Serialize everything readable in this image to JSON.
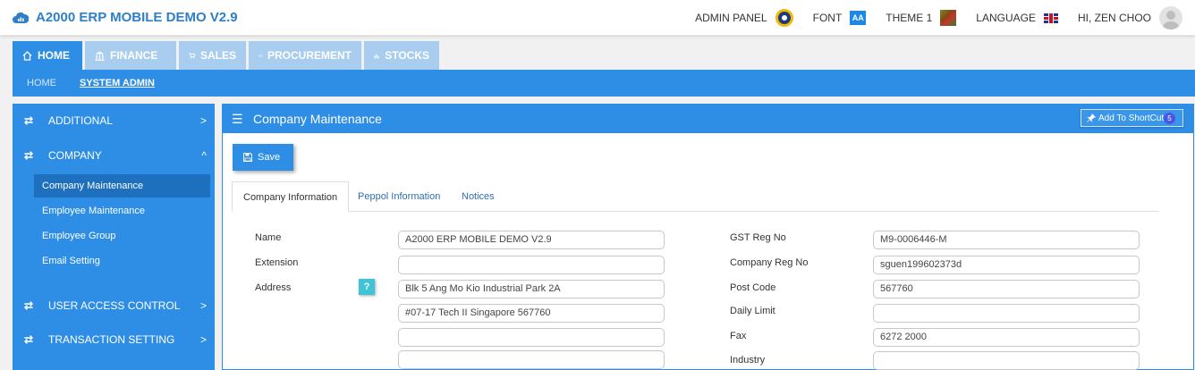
{
  "app": {
    "title": "A2000 ERP MOBILE DEMO V2.9"
  },
  "header": {
    "admin_panel": "ADMIN PANEL",
    "font": "FONT",
    "font_icon_text": "AA",
    "theme": "THEME 1",
    "language": "LANGUAGE",
    "user": "HI, ZEN CHOO"
  },
  "modules": [
    {
      "label": "HOME",
      "icon": "home-icon",
      "active": true
    },
    {
      "label": "FINANCE",
      "icon": "bank-icon",
      "active": false
    },
    {
      "label": "SALES",
      "icon": "cart-icon",
      "active": false
    },
    {
      "label": "PROCUREMENT",
      "icon": "megaphone-icon",
      "active": false
    },
    {
      "label": "STOCKS",
      "icon": "bar-chart-icon",
      "active": false
    }
  ],
  "subnav": {
    "items": [
      "HOME",
      "SYSTEM ADMIN"
    ],
    "current": "SYSTEM ADMIN"
  },
  "sidebar": {
    "sections": [
      {
        "label": "ADDITIONAL",
        "chevron": ">"
      },
      {
        "label": "COMPANY",
        "chevron": "^"
      },
      {
        "label": "USER ACCESS CONTROL",
        "chevron": ">"
      },
      {
        "label": "TRANSACTION SETTING",
        "chevron": ">"
      }
    ],
    "company_items": [
      "Company Maintenance",
      "Employee Maintenance",
      "Employee Group",
      "Email Setting"
    ],
    "selected": "Company Maintenance"
  },
  "panel": {
    "title": "Company Maintenance",
    "shortcut_label": "Add To ShortCut",
    "shortcut_badge": "5",
    "save_label": "Save",
    "tabs": [
      "Company Information",
      "Peppol Information",
      "Notices"
    ],
    "active_tab": "Company Information",
    "help_glyph": "?"
  },
  "form": {
    "left": {
      "name_label": "Name",
      "name_value": "A2000 ERP  MOBILE DEMO V2.9",
      "extension_label": "Extension",
      "extension_value": "",
      "address_label": "Address",
      "address_1": "Blk 5 Ang Mo Kio Industrial Park 2A",
      "address_2": "#07-17 Tech II Singapore 567760",
      "address_3": "",
      "address_4": ""
    },
    "right": {
      "gst_label": "GST Reg No",
      "gst_value": "M9-0006446-M",
      "company_reg_label": "Company Reg No",
      "company_reg_value": "sguen199602373d",
      "post_code_label": "Post Code",
      "post_code_value": "567760",
      "daily_limit_label": "Daily Limit",
      "daily_limit_value": "",
      "fax_label": "Fax",
      "fax_value": "6272 2000",
      "industry_label": "Industry",
      "industry_value": ""
    }
  },
  "colors": {
    "primary": "#2e8ee6",
    "inactive_tab": "#a9cdee",
    "selected_item": "#1f6fbf",
    "brand_text": "#2f7fc6"
  }
}
